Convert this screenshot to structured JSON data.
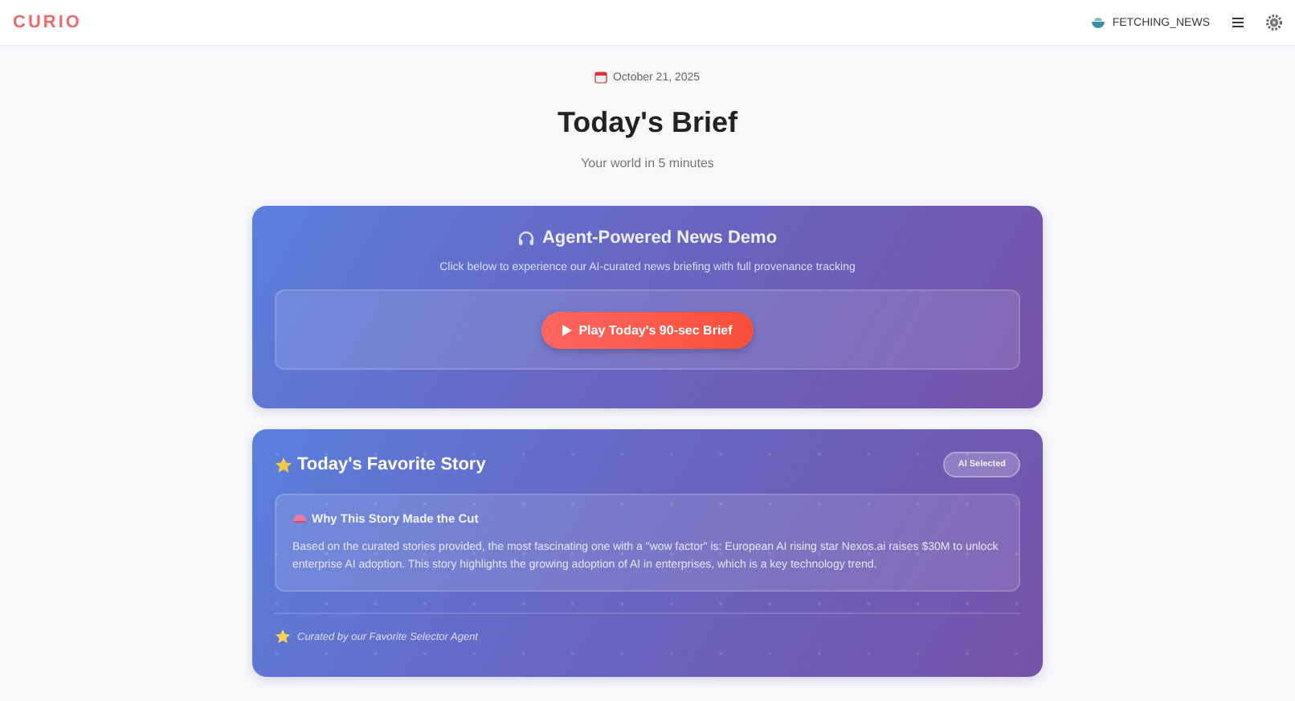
{
  "header": {
    "logo": "CURIO",
    "status": "FETCHING_NEWS"
  },
  "hero": {
    "date": "October 21, 2025",
    "title": "Today's Brief",
    "subtitle": "Your world in 5 minutes"
  },
  "demo_card": {
    "title": "Agent-Powered News Demo",
    "description": "Click below to experience our AI-curated news briefing with full provenance tracking",
    "play_button": "Play Today's 90-sec Brief"
  },
  "favorite_card": {
    "title": "Today's Favorite Story",
    "badge": "AI Selected",
    "reason_title": "Why This Story Made the Cut",
    "reason_text": "Based on the curated stories provided, the most fascinating one with a \"wow factor\" is: European AI rising star Nexos.ai raises $30M to unlock enterprise AI adoption. This story highlights the growing adoption of AI in enterprises, which is a key technology trend.",
    "footer": "Curated by our Favorite Selector Agent"
  }
}
